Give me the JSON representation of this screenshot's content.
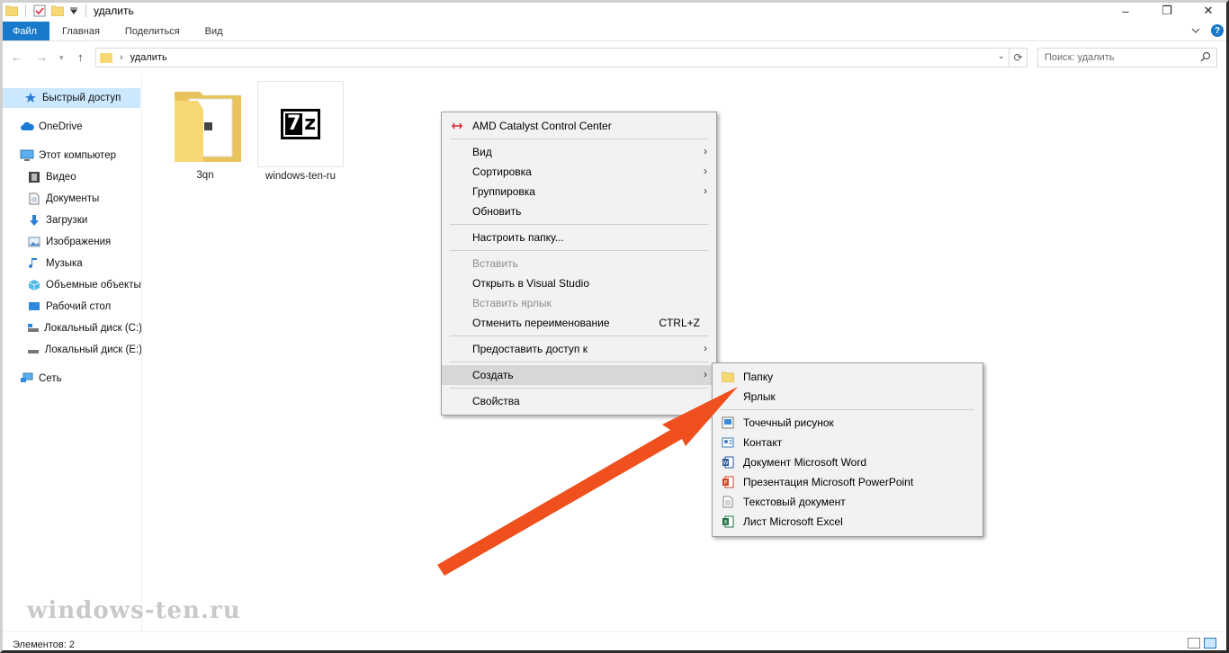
{
  "window": {
    "title": "удалить",
    "minimize": "–",
    "maximize": "❐",
    "close": "✕"
  },
  "ribbon": {
    "tabs": [
      "Файл",
      "Главная",
      "Поделиться",
      "Вид"
    ],
    "help": "?"
  },
  "address": {
    "path": "удалить"
  },
  "search": {
    "placeholder": "Поиск: удалить"
  },
  "sidebar": {
    "items": [
      {
        "label": "Быстрый доступ",
        "icon": "star-icon"
      },
      {
        "label": "OneDrive",
        "icon": "cloud-icon"
      },
      {
        "label": "Этот компьютер",
        "icon": "computer-icon"
      },
      {
        "label": "Видео",
        "icon": "video-icon"
      },
      {
        "label": "Документы",
        "icon": "documents-icon"
      },
      {
        "label": "Загрузки",
        "icon": "download-icon"
      },
      {
        "label": "Изображения",
        "icon": "images-icon"
      },
      {
        "label": "Музыка",
        "icon": "music-icon"
      },
      {
        "label": "Объемные объекты",
        "icon": "3d-objects-icon"
      },
      {
        "label": "Рабочий стол",
        "icon": "desktop-icon"
      },
      {
        "label": "Локальный диск (C:)",
        "icon": "drive-icon"
      },
      {
        "label": "Локальный диск (E:)",
        "icon": "drive-icon"
      },
      {
        "label": "Сеть",
        "icon": "network-icon"
      }
    ]
  },
  "files": [
    {
      "name": "3qn",
      "type": "folder"
    },
    {
      "name": "windows-ten-ru",
      "type": "7z-archive"
    }
  ],
  "context_menu": {
    "amd": "AMD Catalyst Control Center",
    "view": "Вид",
    "sort": "Сортировка",
    "group": "Группировка",
    "refresh": "Обновить",
    "customize": "Настроить папку...",
    "paste": "Вставить",
    "open_vs": "Открыть в Visual Studio",
    "paste_shortcut": "Вставить ярлык",
    "undo_rename": "Отменить переименование",
    "undo_shortcut": "CTRL+Z",
    "share": "Предоставить доступ к",
    "new": "Создать",
    "properties": "Свойства"
  },
  "new_submenu": {
    "folder": "Папку",
    "shortcut": "Ярлык",
    "bitmap": "Точечный рисунок",
    "contact": "Контакт",
    "word": "Документ Microsoft Word",
    "powerpoint": "Презентация Microsoft PowerPoint",
    "text": "Текстовый документ",
    "excel": "Лист Microsoft Excel"
  },
  "status": {
    "count": "Элементов: 2"
  },
  "watermark": "windows-ten.ru",
  "colors": {
    "accent": "#1979ca",
    "arrow": "#f0501e",
    "folder": "#f8d775"
  }
}
